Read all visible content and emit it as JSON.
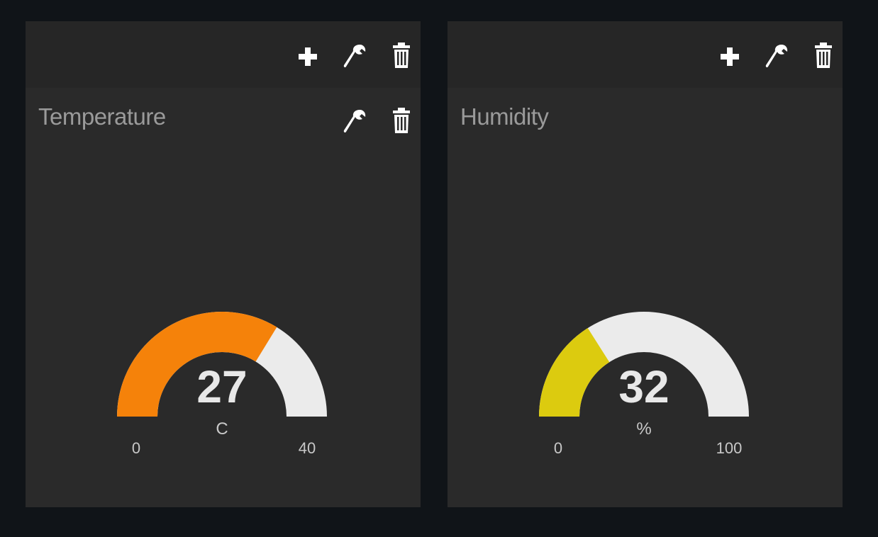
{
  "widgets": [
    {
      "title": "Temperature",
      "value": 27,
      "value_label": "27",
      "unit": "C",
      "min": 0,
      "max": 40,
      "min_label": "0",
      "max_label": "40",
      "color": "#f5820a",
      "track_color": "#ebebeb",
      "toolbar": {
        "add_icon": "plus-icon",
        "edit_icon": "wrench-icon",
        "delete_icon": "trash-icon"
      },
      "header_actions": {
        "edit_icon": "wrench-icon",
        "delete_icon": "trash-icon"
      }
    },
    {
      "title": "Humidity",
      "value": 32,
      "value_label": "32",
      "unit": "%",
      "min": 0,
      "max": 100,
      "min_label": "0",
      "max_label": "100",
      "color": "#dccb0f",
      "track_color": "#ebebeb",
      "toolbar": {
        "add_icon": "plus-icon",
        "edit_icon": "wrench-icon",
        "delete_icon": "trash-icon"
      }
    }
  ]
}
